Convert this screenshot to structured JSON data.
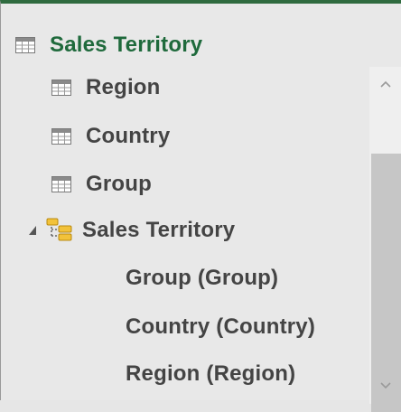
{
  "tree": {
    "table": {
      "label": "Sales Territory",
      "icon": "table-icon",
      "accent_color": "#1f6a3c"
    },
    "columns": [
      {
        "label": "Region",
        "icon": "table-field-icon"
      },
      {
        "label": "Country",
        "icon": "table-field-icon"
      },
      {
        "label": "Group",
        "icon": "table-field-icon"
      }
    ],
    "hierarchy": {
      "label": "Sales Territory",
      "icon": "hierarchy-icon",
      "expanded": true,
      "levels": [
        {
          "label": "Group (Group)"
        },
        {
          "label": "Country (Country)"
        },
        {
          "label": "Region (Region)"
        }
      ]
    }
  },
  "scrollbar": {
    "up_icon": "chevron-up-icon",
    "down_icon": "chevron-down-icon"
  }
}
